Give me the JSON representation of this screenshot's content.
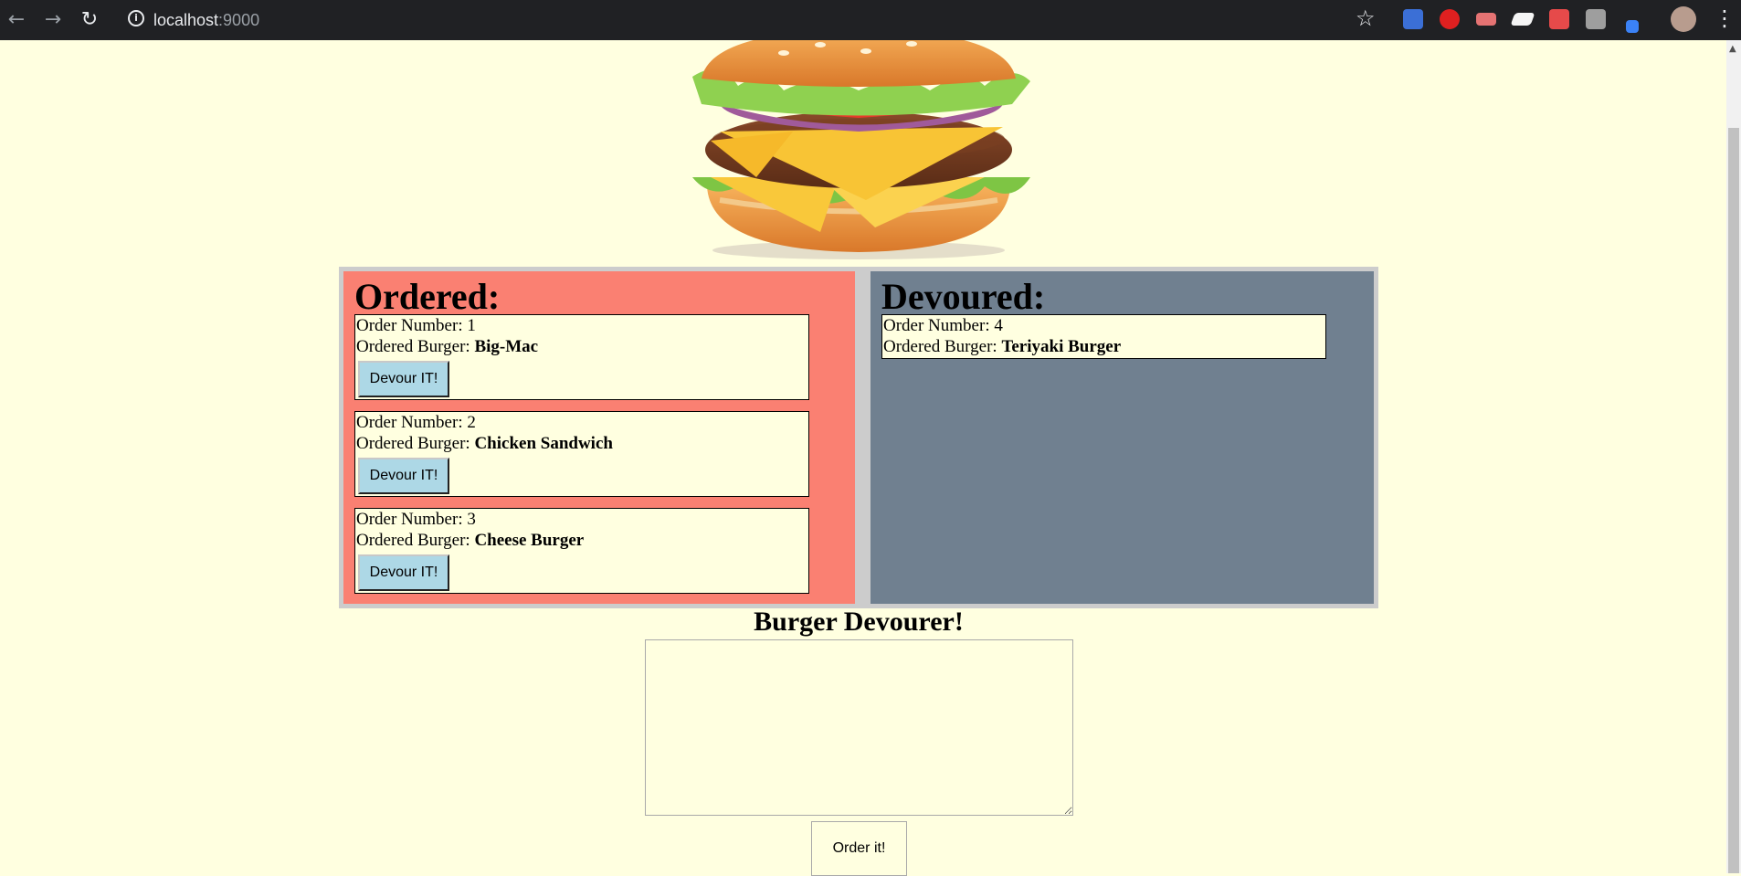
{
  "browser": {
    "url_host": "localhost",
    "url_port": ":9000",
    "extensions": [
      {
        "name": "extension-blue-icon",
        "color": "#3b6fd6"
      },
      {
        "name": "extension-stop-icon",
        "color": "#e02020"
      },
      {
        "name": "extension-video-icon",
        "color": "#e57373"
      },
      {
        "name": "extension-eraser-icon",
        "color": "#f5f5f5"
      },
      {
        "name": "extension-pdf-icon",
        "color": "#e64a4a"
      },
      {
        "name": "extension-r-icon",
        "color": "#9e9e9e"
      },
      {
        "name": "extension-pen-icon",
        "color": "#3b82f6"
      }
    ]
  },
  "ordered": {
    "heading": "Ordered:",
    "background": "#fa8072",
    "items": [
      {
        "order_label": "Order Number: 1",
        "burger_label": "Ordered Burger: ",
        "burger_name": "Big-Mac",
        "button": "Devour IT!"
      },
      {
        "order_label": "Order Number: 2",
        "burger_label": "Ordered Burger: ",
        "burger_name": "Chicken Sandwich",
        "button": "Devour IT!"
      },
      {
        "order_label": "Order Number: 3",
        "burger_label": "Ordered Burger: ",
        "burger_name": "Cheese Burger",
        "button": "Devour IT!"
      }
    ]
  },
  "devoured": {
    "heading": "Devoured:",
    "background": "#708090",
    "items": [
      {
        "order_label": "Order Number: 4",
        "burger_label": "Ordered Burger: ",
        "burger_name": "Teriyaki Burger"
      }
    ]
  },
  "form": {
    "title": "Burger Devourer!",
    "input_value": "",
    "submit_label": "Order it!"
  }
}
